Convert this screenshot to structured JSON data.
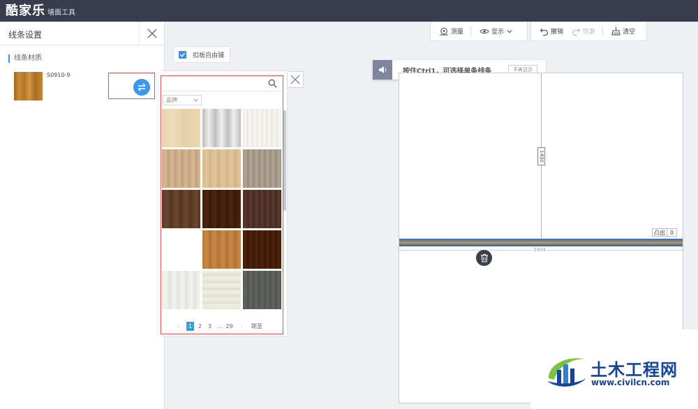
{
  "app": {
    "logo_main": "酷家乐",
    "logo_sub": "墙面工具"
  },
  "left_panel": {
    "title": "线条设置",
    "section_label": "线条材质",
    "material": {
      "code": "S0910-9"
    }
  },
  "option": {
    "free_tile_label": "扣板自由铺",
    "checked": true
  },
  "picker": {
    "search_placeholder": "",
    "brand_select": "品牌",
    "pagination": {
      "prev": "‹",
      "pages": [
        "1",
        "2",
        "3"
      ],
      "ellipsis": "...",
      "last": "29",
      "next": "›",
      "jump": "跳至",
      "current": "1"
    }
  },
  "toolbar": {
    "measure": "测量",
    "display": "显示",
    "undo": "撤销",
    "redo": "恢复",
    "clear": "清空"
  },
  "hint": {
    "text": "按住Ctrl1，可选择单条线条",
    "dismiss": "不再显示"
  },
  "canvas": {
    "dim_vertical": "1400",
    "dim_horizontal": "2404",
    "protrude_label": "凸出",
    "protrude_value": "0"
  },
  "watermark": {
    "title": "土木工程网",
    "url": "www.civilcn.com"
  },
  "colors": {
    "topbar": "#383c4d",
    "accent_blue": "#3d8fe8",
    "highlight_red": "#e05656",
    "watermark_blue": "#16449a"
  }
}
